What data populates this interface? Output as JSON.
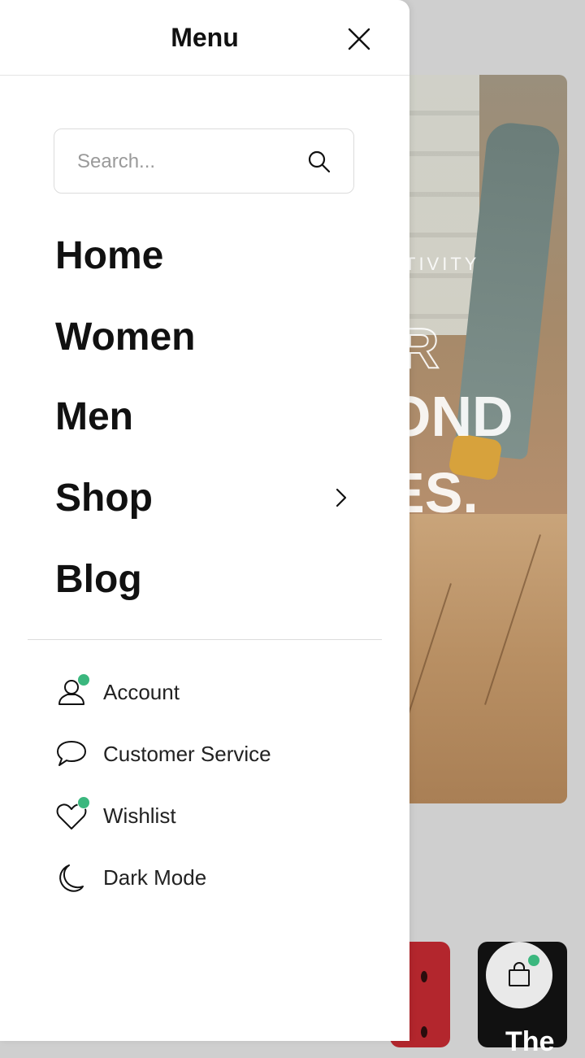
{
  "drawer": {
    "title": "Menu",
    "search": {
      "placeholder": "Search..."
    },
    "nav": [
      {
        "label": "Home"
      },
      {
        "label": "Women"
      },
      {
        "label": "Men"
      },
      {
        "label": "Shop",
        "has_submenu": true
      },
      {
        "label": "Blog"
      }
    ],
    "utility": [
      {
        "label": "Account",
        "icon": "user-icon",
        "badge": true
      },
      {
        "label": "Customer Service",
        "icon": "chat-bubble-icon",
        "badge": false
      },
      {
        "label": "Wishlist",
        "icon": "heart-icon",
        "badge": true
      },
      {
        "label": "Dark Mode",
        "icon": "moon-icon",
        "badge": false
      }
    ]
  },
  "background": {
    "hero": {
      "eyebrow": "TIVITY",
      "line1": "R",
      "line2": "OND",
      "line3": "ES."
    },
    "tile_text": "The"
  },
  "colors": {
    "badge": "#3bb77e",
    "overlay": "#cfcfcf",
    "text": "#111111"
  }
}
